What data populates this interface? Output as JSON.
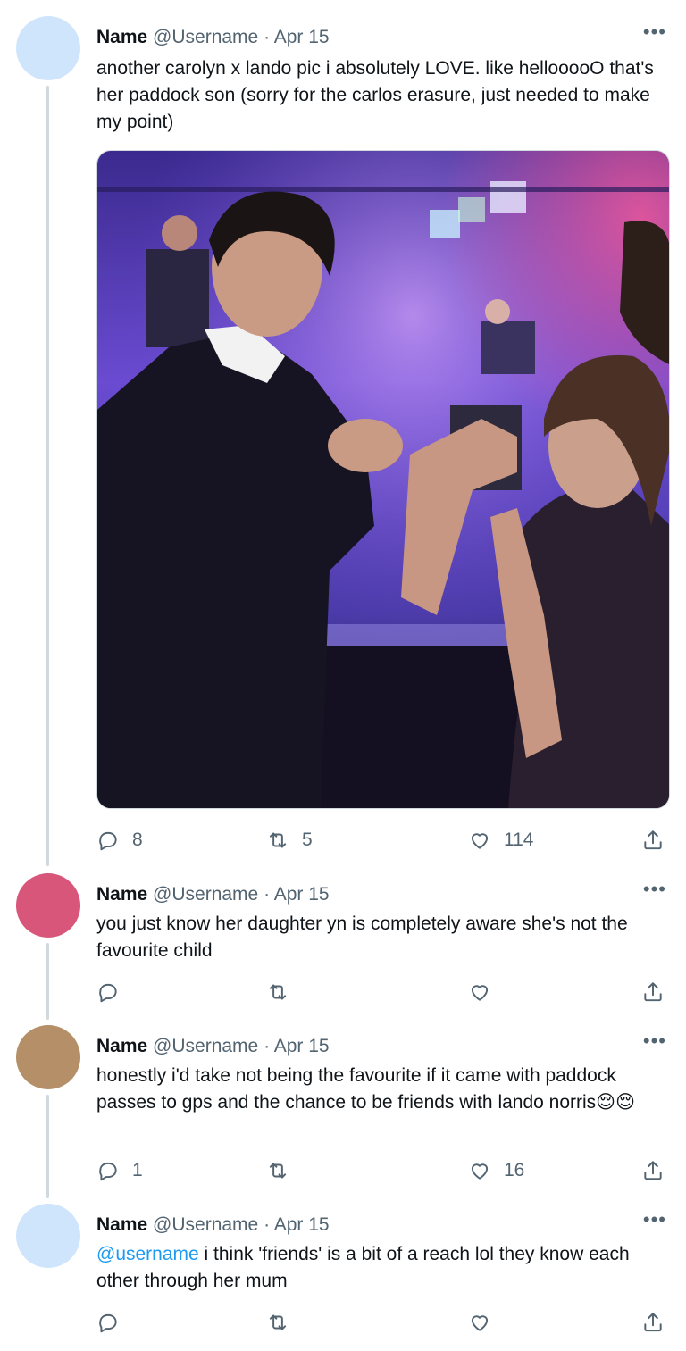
{
  "colors": {
    "avatar_1": "#cfe5fb",
    "avatar_2": "#d8567a",
    "avatar_3": "#b48f67",
    "avatar_4": "#cfe5fb",
    "mention": "#1d9bf0",
    "muted": "#536471",
    "thread_line": "#cfd9de"
  },
  "tweets": [
    {
      "name": "Name",
      "meta": "@Username · Apr 15",
      "text": "another carolyn x lando pic i absolutely LOVE. like hellooooO that's her paddock son (sorry for the carlos erasure, just needed to make my point)",
      "replies": "8",
      "retweets": "5",
      "likes": "114"
    },
    {
      "name": "Name",
      "meta": "@Username · Apr 15",
      "text": "you just know her daughter yn is completely aware she's not the favourite child",
      "replies": "",
      "retweets": "",
      "likes": ""
    },
    {
      "name": "Name",
      "meta": "@Username · Apr 15",
      "text": "honestly i'd take not being the favourite if it came with paddock passes to gps and the chance to be friends with lando norris😌😌",
      "replies": "1",
      "retweets": "",
      "likes": "16"
    },
    {
      "name": "Name",
      "meta": "@Username · Apr 15",
      "mention": "@username",
      "text": " i think 'friends' is a bit of a reach lol they know each other through her mum",
      "replies": "",
      "retweets": "",
      "likes": ""
    }
  ],
  "icons": {
    "more": "more-horizontal-icon",
    "reply": "reply-icon",
    "retweet": "retweet-icon",
    "like": "heart-icon",
    "share": "share-icon"
  }
}
